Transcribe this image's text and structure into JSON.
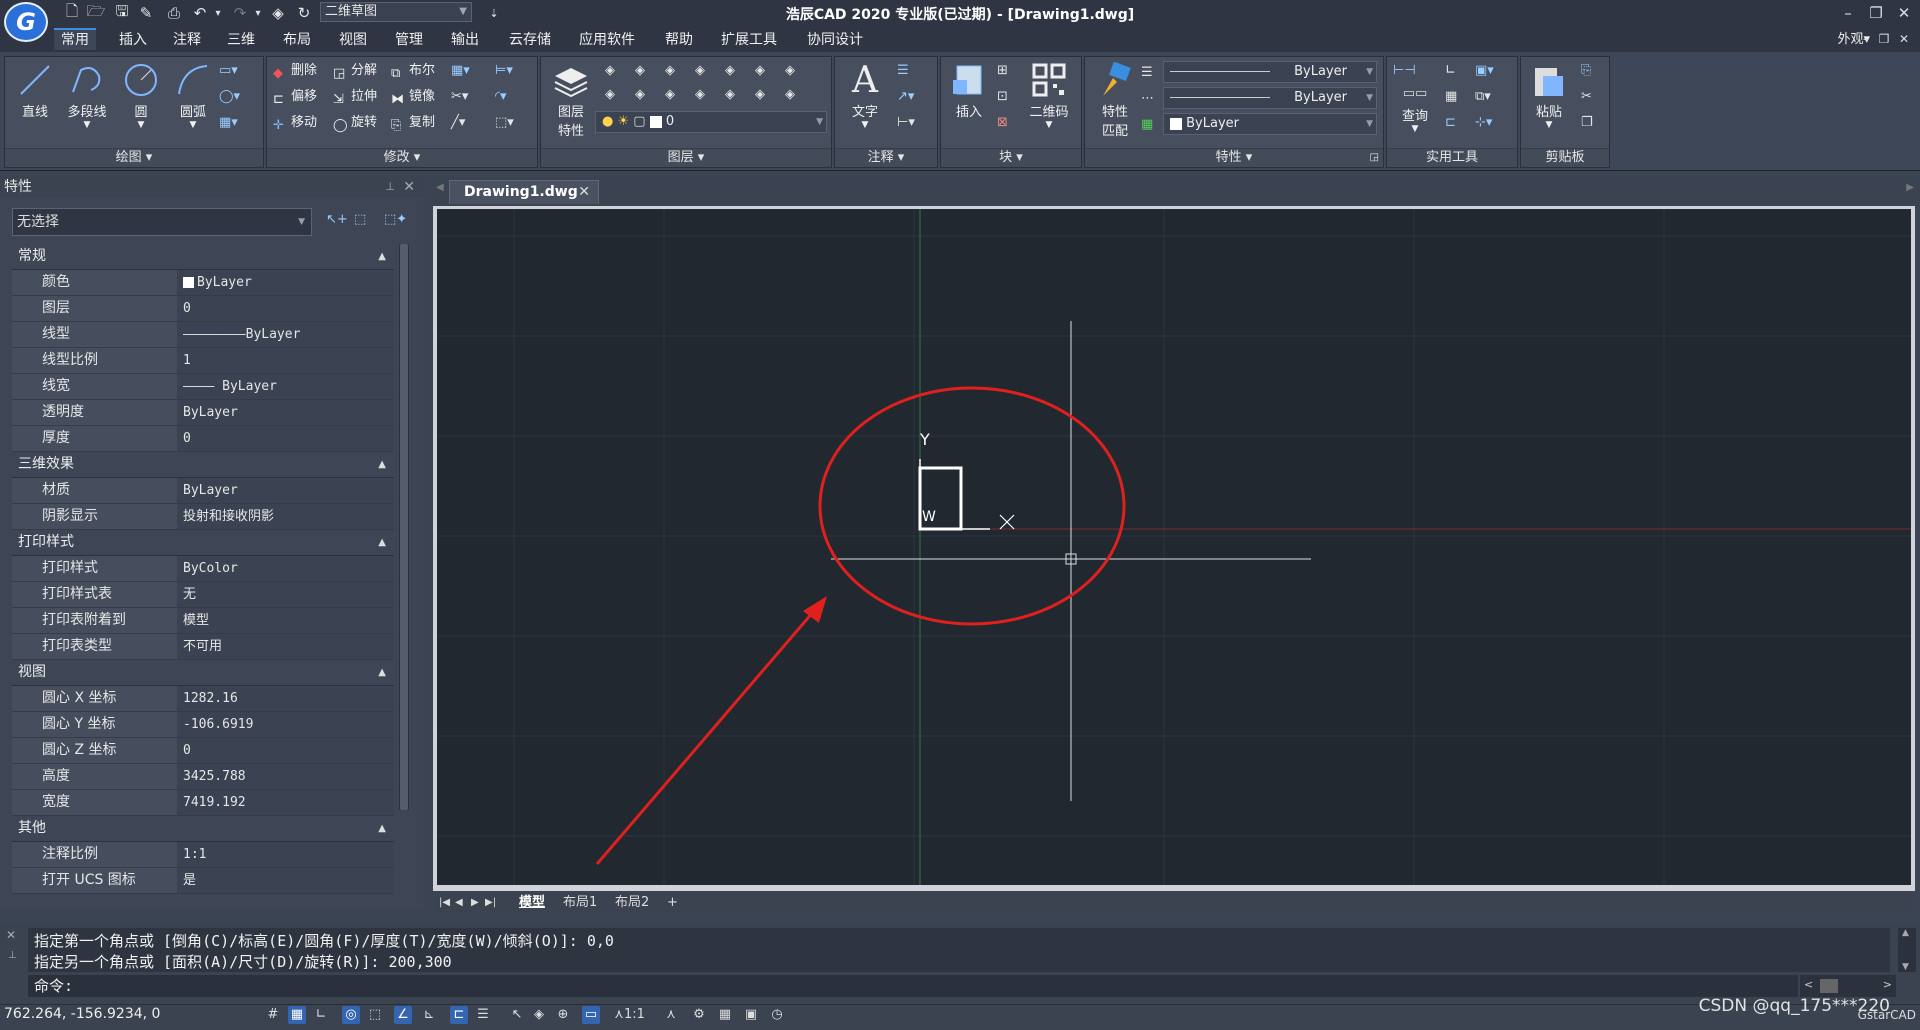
{
  "window": {
    "title": "浩辰CAD 2020 专业版(已过期) - [Drawing1.dwg]",
    "workspace": "二维草图",
    "workspace_switch": "外观"
  },
  "menu_tabs": [
    "常用",
    "插入",
    "注释",
    "三维",
    "布局",
    "视图",
    "管理",
    "输出",
    "云存储",
    "应用软件",
    "帮助",
    "扩展工具",
    "协同设计"
  ],
  "ribbon": {
    "draw": {
      "title": "绘图",
      "line": "直线",
      "polyline": "多段线",
      "circle": "圆",
      "arc": "圆弧"
    },
    "modify": {
      "title": "修改",
      "erase": "删除",
      "explode": "分解",
      "boolean": "布尔",
      "offset": "偏移",
      "stretch": "拉伸",
      "mirror": "镜像",
      "move": "移动",
      "rotate": "旋转",
      "copy": "复制"
    },
    "layer": {
      "title": "图层",
      "props_line1": "图层",
      "props_line2": "特性",
      "current_layer": "0"
    },
    "annotation": {
      "title": "注释",
      "text": "文字"
    },
    "block": {
      "title": "块",
      "insert": "插入",
      "qrcode": "二维码"
    },
    "properties": {
      "title": "特性",
      "match_line1": "特性",
      "match_line2": "匹配",
      "linetype": "ByLayer",
      "lineweight": "ByLayer",
      "color": "ByLayer"
    },
    "utilities": {
      "title": "实用工具",
      "query": "查询"
    },
    "clipboard": {
      "title": "剪贴板",
      "paste": "粘贴"
    }
  },
  "properties_panel": {
    "title": "特性",
    "selection": "无选择",
    "sections": [
      {
        "name": "常规",
        "rows": [
          [
            "颜色",
            "ByLayer"
          ],
          [
            "图层",
            "0"
          ],
          [
            "线型",
            "————————ByLayer"
          ],
          [
            "线型比例",
            "1"
          ],
          [
            "线宽",
            "———— ByLayer"
          ],
          [
            "透明度",
            "ByLayer"
          ],
          [
            "厚度",
            "0"
          ]
        ]
      },
      {
        "name": "三维效果",
        "rows": [
          [
            "材质",
            "ByLayer"
          ],
          [
            "阴影显示",
            "投射和接收阴影"
          ]
        ]
      },
      {
        "name": "打印样式",
        "rows": [
          [
            "打印样式",
            "ByColor"
          ],
          [
            "打印样式表",
            "无"
          ],
          [
            "打印表附着到",
            "模型"
          ],
          [
            "打印表类型",
            "不可用"
          ]
        ]
      },
      {
        "name": "视图",
        "rows": [
          [
            "圆心 X 坐标",
            "1282.16"
          ],
          [
            "圆心 Y 坐标",
            "-106.6919"
          ],
          [
            "圆心 Z 坐标",
            "0"
          ],
          [
            "高度",
            "3425.788"
          ],
          [
            "宽度",
            "7419.192"
          ]
        ]
      },
      {
        "name": "其他",
        "rows": [
          [
            "注释比例",
            "1:1"
          ],
          [
            "打开 UCS 图标",
            "是"
          ]
        ]
      }
    ]
  },
  "document_tab": "Drawing1.dwg",
  "layout_tabs": [
    "模型",
    "布局1",
    "布局2",
    "+"
  ],
  "ucs": {
    "y_label": "Y",
    "w_label": "W"
  },
  "command": {
    "history": [
      "指定第一个角点或 [倒角(C)/标高(E)/圆角(F)/厚度(T)/宽度(W)/倾斜(O)]: 0,0",
      "指定另一个角点或 [面积(A)/尺寸(D)/旋转(R)]: 200,300"
    ],
    "prompt": "命令:"
  },
  "status": {
    "coordinates": "762.264, -156.9234, 0",
    "scale": "1:1",
    "watermark": "CSDN @qq_175***220",
    "brand": "GstarCAD"
  },
  "colors": {
    "accent": "#3c8ee0",
    "annotation": "#e0201c",
    "canvas": "#212830"
  }
}
